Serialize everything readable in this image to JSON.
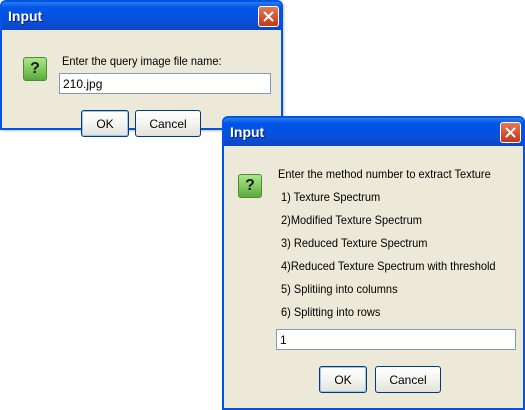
{
  "dialog1": {
    "title": "Input",
    "prompt": "Enter the query image file name:",
    "input_value": "210.jpg",
    "ok_label": "OK",
    "cancel_label": "Cancel",
    "icon": "question-icon"
  },
  "dialog2": {
    "title": "Input",
    "prompt": "Enter the method number to extract Texture",
    "options": [
      "1) Texture Spectrum",
      "2)Modified Texture Spectrum",
      "3) Reduced Texture Spectrum",
      "4)Reduced Texture Spectrum with threshold",
      "5) Splitiing into columns",
      "6) Splitting into rows"
    ],
    "input_value": "1",
    "ok_label": "OK",
    "cancel_label": "Cancel",
    "icon": "question-icon"
  },
  "colors": {
    "titlebar": "#0055ea",
    "dialog_bg": "#ece9d8",
    "close_button": "#d45a3a",
    "question_icon": "#7ac65a"
  }
}
